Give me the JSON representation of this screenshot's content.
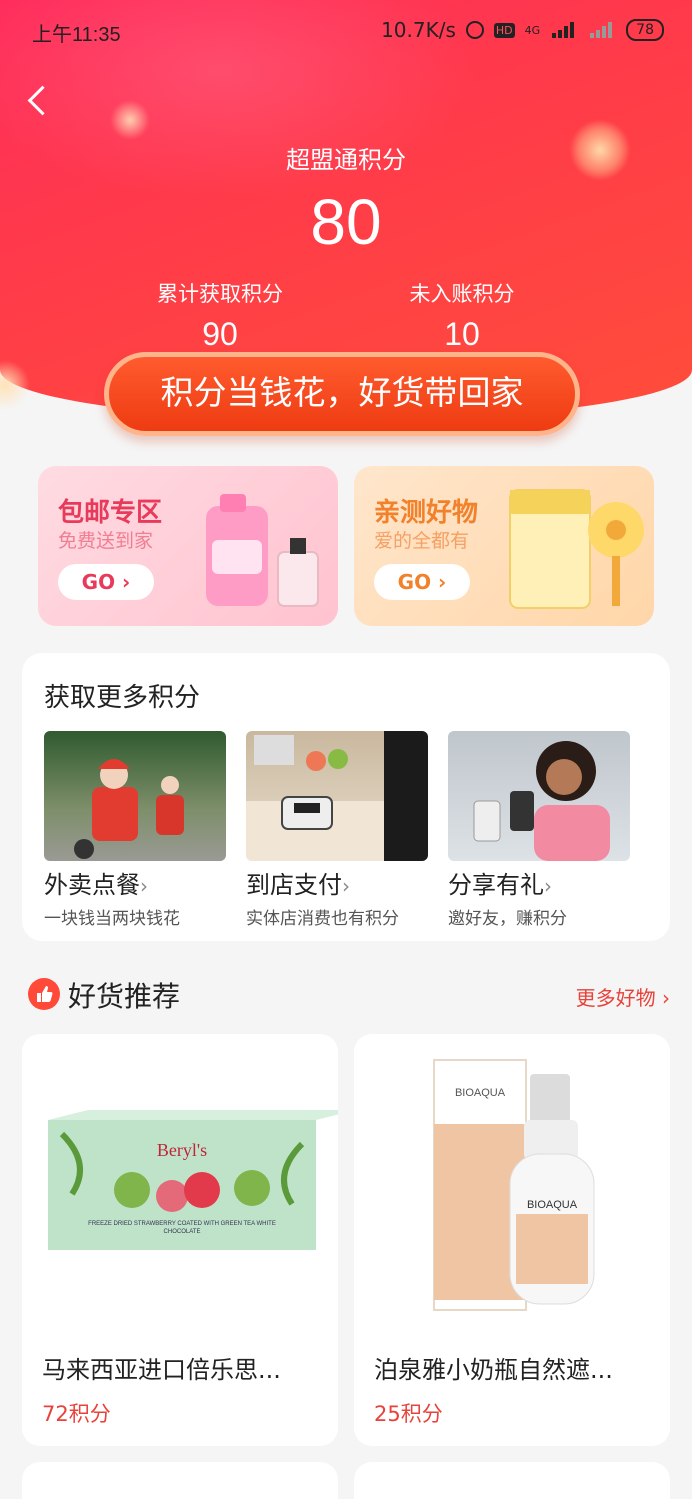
{
  "status_bar": {
    "time": "上午11:35",
    "net_speed": "10.7K/s",
    "hd": "HD",
    "network": "4G",
    "battery": "78"
  },
  "header": {
    "title": "超盟通积分",
    "points": "80",
    "stats": [
      {
        "label": "累计获取积分",
        "value": "90"
      },
      {
        "label": "未入账积分",
        "value": "10"
      }
    ],
    "slogan": "积分当钱花，好货带回家"
  },
  "promos": [
    {
      "title": "包邮专区",
      "subtitle": "免费送到家",
      "go": "GO"
    },
    {
      "title": "亲测好物",
      "subtitle": "爱的全都有",
      "go": "GO"
    }
  ],
  "earn": {
    "title": "获取更多积分",
    "items": [
      {
        "name": "外卖点餐",
        "desc": "一块钱当两块钱花"
      },
      {
        "name": "到店支付",
        "desc": "实体店消费也有积分"
      },
      {
        "name": "分享有礼",
        "desc": "邀好友，赚积分"
      }
    ]
  },
  "recommend": {
    "title": "好货推荐",
    "more": "更多好物",
    "products": [
      {
        "name": "马来西亚进口倍乐思...",
        "price": "72积分",
        "brand": "Beryl's",
        "pack_text": "FREEZE DRIED STRAWBERRY COATED WITH GREEN TEA WHITE CHOCOLATE"
      },
      {
        "name": "泊泉雅小奶瓶自然遮...",
        "price": "25积分",
        "brand": "BIOAQUA"
      }
    ]
  },
  "colors": {
    "primary": "#ff3a4a",
    "accent_red": "#e8423a",
    "pink_card": "#ffd3dc",
    "orange_card": "#ffe2c4"
  }
}
